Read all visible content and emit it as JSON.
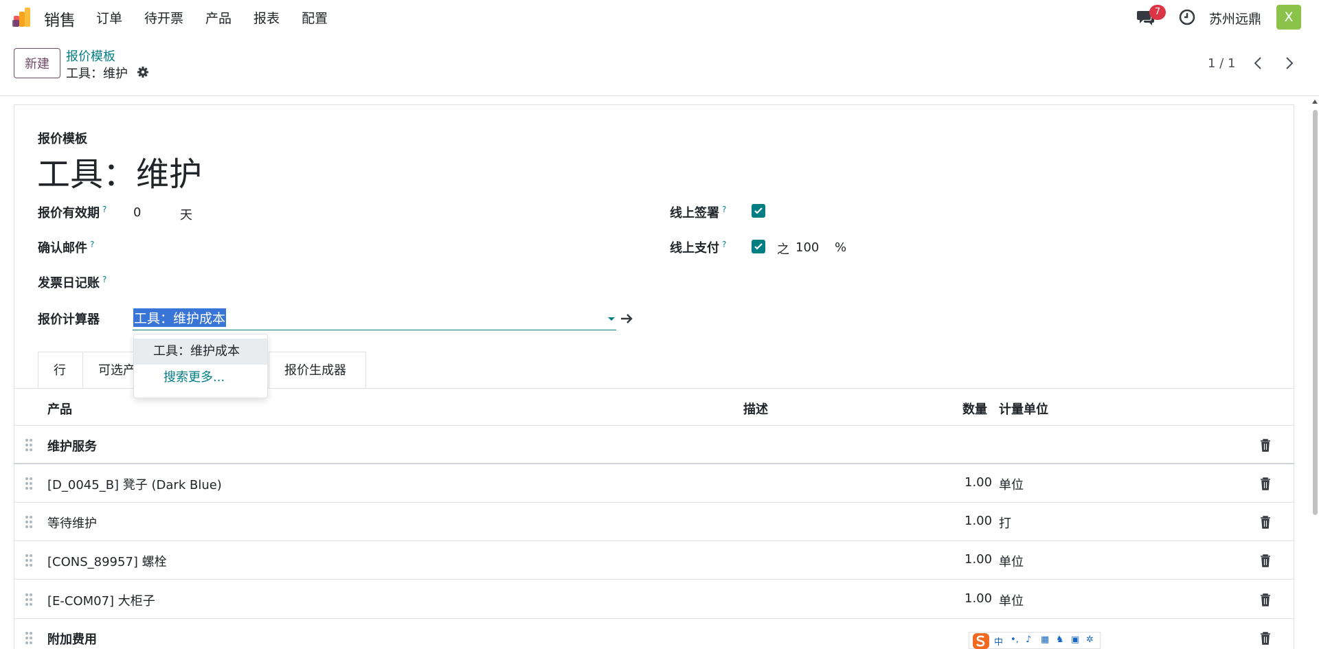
{
  "navbar": {
    "app_name": "销售",
    "menu": [
      "订单",
      "待开票",
      "产品",
      "报表",
      "配置"
    ],
    "chat_badge": "7",
    "company": "苏州远鼎",
    "avatar_letter": "X"
  },
  "control_panel": {
    "new_label": "新建",
    "breadcrumb_parent": "报价模板",
    "breadcrumb_current": "工具：维护",
    "pager": "1 / 1"
  },
  "form": {
    "small_title": "报价模板",
    "title": "工具：维护",
    "validity_label": "报价有效期",
    "validity_value": "0",
    "validity_unit": "天",
    "confirm_mail_label": "确认邮件",
    "journal_label": "发票日记账",
    "calculator_label": "报价计算器",
    "calculator_value": "工具：维护成本",
    "signature_label": "线上签署",
    "payment_label": "线上支付",
    "payment_prefix": "之",
    "payment_value": "100",
    "payment_unit": "%",
    "help_mark": "?"
  },
  "dropdown": {
    "option": "工具：维护成本",
    "search_more": "搜索更多..."
  },
  "tabs": [
    "行",
    "可选产",
    "报价生成器"
  ],
  "table": {
    "headers": {
      "product": "产品",
      "description": "描述",
      "quantity": "数量",
      "uom": "计量单位"
    },
    "rows": [
      {
        "type": "section",
        "product": "维护服务"
      },
      {
        "type": "line",
        "product": "[D_0045_B] 凳子 (Dark Blue)",
        "quantity": "1.00",
        "uom": "单位"
      },
      {
        "type": "line",
        "product": "等待维护",
        "quantity": "1.00",
        "uom": "打"
      },
      {
        "type": "line",
        "product": "[CONS_89957] 螺栓",
        "quantity": "1.00",
        "uom": "单位"
      },
      {
        "type": "line",
        "product": "[E-COM07] 大柜子",
        "quantity": "1.00",
        "uom": "单位"
      },
      {
        "type": "section",
        "product": "附加费用"
      }
    ]
  },
  "ime": {
    "glyphs": [
      "中",
      "•,",
      "♪",
      "▦",
      "♞",
      "▣",
      "✲"
    ]
  },
  "colors": {
    "brand": "#714b67",
    "accent": "#017e84",
    "badge": "#dc3545",
    "avatar": "#8bc34a",
    "selection": "#3875d7"
  }
}
